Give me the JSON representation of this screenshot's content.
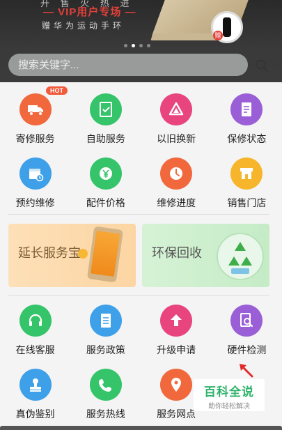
{
  "banner": {
    "top_line": "开 售 火 热 进",
    "headline": "— VIP用户专场 —",
    "subline": "赠华为运动手环",
    "gift_badge": "赠",
    "dots": 4,
    "active_dot": 1
  },
  "search": {
    "placeholder": "搜索关键字..."
  },
  "row1": [
    {
      "label": "寄修服务",
      "icon": "truck-icon",
      "color": "#f1683c",
      "badge": "HOT"
    },
    {
      "label": "自助服务",
      "icon": "checklist-icon",
      "color": "#35c46a"
    },
    {
      "label": "以旧换新",
      "icon": "exchange-icon",
      "color": "#e8457e"
    },
    {
      "label": "保修状态",
      "icon": "document-icon",
      "color": "#9a5fd6"
    }
  ],
  "row2": [
    {
      "label": "预约维修",
      "icon": "calendar-icon",
      "color": "#3ea0e8"
    },
    {
      "label": "配件价格",
      "icon": "yen-icon",
      "color": "#35c46a"
    },
    {
      "label": "维修进度",
      "icon": "clock-icon",
      "color": "#f1683c"
    },
    {
      "label": "销售门店",
      "icon": "store-icon",
      "color": "#f6b52b"
    }
  ],
  "cards": {
    "extend": {
      "title": "延长服务宝"
    },
    "recycle": {
      "title": "环保回收"
    }
  },
  "row3": [
    {
      "label": "在线客服",
      "icon": "headset-icon",
      "color": "#35c46a"
    },
    {
      "label": "服务政策",
      "icon": "policy-icon",
      "color": "#3ea0e8"
    },
    {
      "label": "升级申请",
      "icon": "upload-icon",
      "color": "#e8457e"
    },
    {
      "label": "硬件检测",
      "icon": "magnify-document-icon",
      "color": "#9a5fd6"
    }
  ],
  "row4": [
    {
      "label": "真伪鉴别",
      "icon": "stamp-icon",
      "color": "#3ea0e8"
    },
    {
      "label": "服务热线",
      "icon": "phone-icon",
      "color": "#35c46a"
    },
    {
      "label": "服务网点",
      "icon": "location-icon",
      "color": "#f1683c"
    }
  ],
  "watermark": {
    "title": "百科全说",
    "subtitle": "助你轻松解决"
  }
}
